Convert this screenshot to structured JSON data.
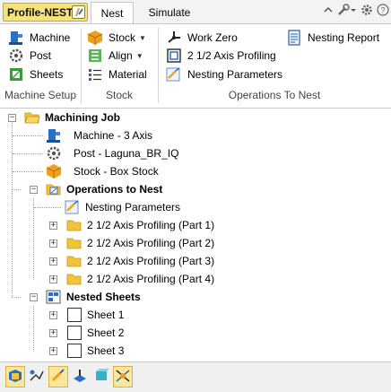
{
  "app_button": {
    "label": "Profile-NEST"
  },
  "tabs": [
    {
      "label": "Nest",
      "active": true
    },
    {
      "label": "Simulate",
      "active": false
    }
  ],
  "top_icons": [
    "chevron-up-icon",
    "wrench-icon",
    "gear-icon",
    "help-icon"
  ],
  "ribbon": {
    "machine_setup": {
      "label": "Machine Setup",
      "buttons": [
        {
          "label": "Machine",
          "icon": "machine-icon"
        },
        {
          "label": "Post",
          "icon": "post-icon"
        },
        {
          "label": "Sheets",
          "icon": "sheets-icon"
        }
      ]
    },
    "stock": {
      "label": "Stock",
      "buttons": [
        {
          "label": "Stock",
          "icon": "stock-icon",
          "dropdown": true
        },
        {
          "label": "Align",
          "icon": "align-icon",
          "dropdown": true
        },
        {
          "label": "Material",
          "icon": "material-icon"
        }
      ]
    },
    "operations": {
      "label": "Operations To Nest",
      "buttons": [
        {
          "label": "Work Zero",
          "icon": "work-zero-icon"
        },
        {
          "label": "2 1/2 Axis Profiling",
          "icon": "profiling-icon"
        },
        {
          "label": "Nesting Parameters",
          "icon": "nesting-parameters-icon"
        },
        {
          "label": "Nesting Report",
          "icon": "nesting-report-icon"
        }
      ]
    }
  },
  "tree": {
    "root": "Machining Job",
    "machine": "Machine - 3 Axis",
    "post": "Post - Laguna_BR_IQ",
    "stock": "Stock - Box Stock",
    "operations": {
      "label": "Operations to Nest",
      "parameters": "Nesting Parameters",
      "items": [
        "2 1/2 Axis Profiling (Part 1)",
        "2 1/2 Axis Profiling (Part 2)",
        "2 1/2 Axis Profiling (Part 3)",
        "2 1/2 Axis Profiling (Part 4)"
      ]
    },
    "nested_sheets": {
      "label": "Nested Sheets",
      "items": [
        "Sheet 1",
        "Sheet 2",
        "Sheet 3"
      ]
    }
  },
  "colors": {
    "accent_yellow": "#f6e27a",
    "folder": "#f2c33c",
    "machine_blue": "#2a6fc4",
    "stock_orange": "#f0a020"
  }
}
